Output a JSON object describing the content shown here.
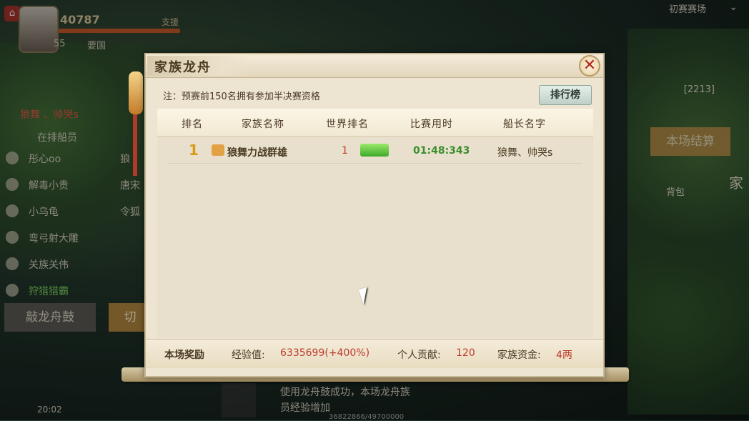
{
  "hud": {
    "power": "40787",
    "level": "55",
    "region_tag": "要国",
    "top_tag": "支援",
    "map_title": "初赛赛场",
    "rank_line": "[2213]"
  },
  "side_panel": {
    "header": "在排船员",
    "status_line": "狼舞 、帅哭s",
    "members": [
      {
        "name": "彤心oo",
        "extra": "狼"
      },
      {
        "name": "解毒小贵",
        "extra": "唐宋"
      },
      {
        "name": "小乌龟",
        "extra": "令狐"
      },
      {
        "name": "弯弓射大雕",
        "extra": ""
      },
      {
        "name": "关族关伟",
        "extra": ""
      },
      {
        "name": "狩猎猎霸",
        "extra": ""
      }
    ],
    "drum_button": "敲龙舟鼓",
    "switch_button": "切"
  },
  "right_panel": {
    "settle_button": "本场结算",
    "bag": "背包",
    "home": "家"
  },
  "chat": {
    "line1": "使用龙舟鼓成功，本场龙舟族",
    "line2": "员经验增加",
    "time": "20:02",
    "exp_bar": "36822866/49700000"
  },
  "dialog": {
    "title": "家族龙舟",
    "close_glyph": "✕",
    "note": "注：预赛前150名拥有参加半决赛资格",
    "rank_button": "排行榜",
    "columns": [
      "排名",
      "家族名称",
      "世界排名",
      "比赛用时",
      "船长名字"
    ],
    "rows": [
      {
        "rank": "1",
        "family": "狼舞力战群雄",
        "world_rank": "1",
        "time": "01:48:343",
        "captain": "狼舞、帅哭s"
      }
    ],
    "footer": {
      "reward_label": "本场奖励",
      "exp_label": "经验值:",
      "exp_value": "6335699(+400%)",
      "contrib_label": "个人贡献:",
      "contrib_value": "120",
      "fund_label": "家族资金:",
      "fund_value": "4两"
    }
  }
}
